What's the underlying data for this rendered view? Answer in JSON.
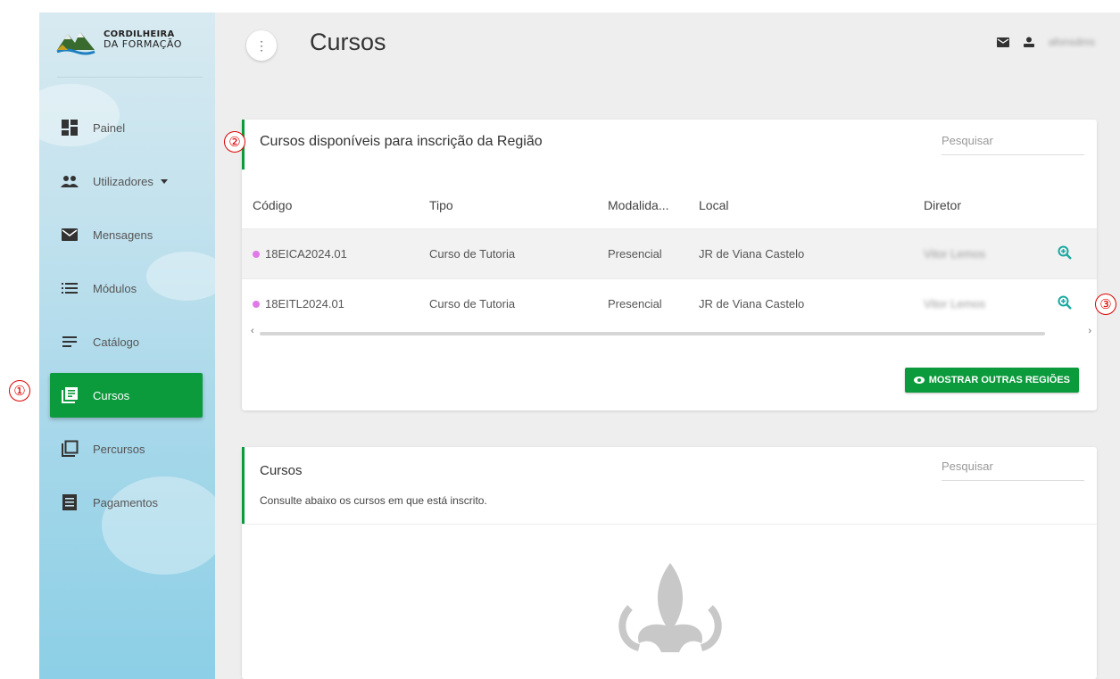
{
  "app": {
    "logo_line1": "CORDILHEIRA",
    "logo_line2": "DA FORMAÇÃO"
  },
  "sidebar": {
    "items": [
      {
        "label": "Painel",
        "icon": "dashboard-icon"
      },
      {
        "label": "Utilizadores",
        "icon": "users-icon"
      },
      {
        "label": "Mensagens",
        "icon": "mail-icon"
      },
      {
        "label": "Módulos",
        "icon": "list-icon"
      },
      {
        "label": "Catálogo",
        "icon": "lines-icon"
      },
      {
        "label": "Cursos",
        "icon": "courses-icon"
      },
      {
        "label": "Percursos",
        "icon": "paths-icon"
      },
      {
        "label": "Pagamentos",
        "icon": "receipt-icon"
      }
    ],
    "active": "Cursos"
  },
  "header": {
    "title": "Cursos",
    "menu_glyph": "⋮",
    "username": "afonsdms"
  },
  "card1": {
    "title": "Cursos disponíveis para inscrição da Região",
    "search_placeholder": "Pesquisar",
    "columns": [
      "Código",
      "Tipo",
      "Modalida...",
      "Local",
      "Diretor"
    ],
    "rows": [
      {
        "codigo": "18EICA2024.01",
        "tipo": "Curso de Tutoria",
        "modalidade": "Presencial",
        "local": "JR de Viana Castelo",
        "diretor": "Vitor Lemos"
      },
      {
        "codigo": "18EITL2024.01",
        "tipo": "Curso de Tutoria",
        "modalidade": "Presencial",
        "local": "JR de Viana Castelo",
        "diretor": "Vitor Lemos"
      }
    ],
    "button_label": "MOSTRAR OUTRAS REGIÕES"
  },
  "card2": {
    "title": "Cursos",
    "subtitle": "Consulte abaixo os cursos em que está inscrito.",
    "search_placeholder": "Pesquisar"
  },
  "annotations": [
    "①",
    "②",
    "③"
  ],
  "colors": {
    "accent": "#0b9a3c",
    "zoom_icon": "#1aa8a0",
    "status_dot": "#e07ae8",
    "marker": "#dd0000"
  }
}
